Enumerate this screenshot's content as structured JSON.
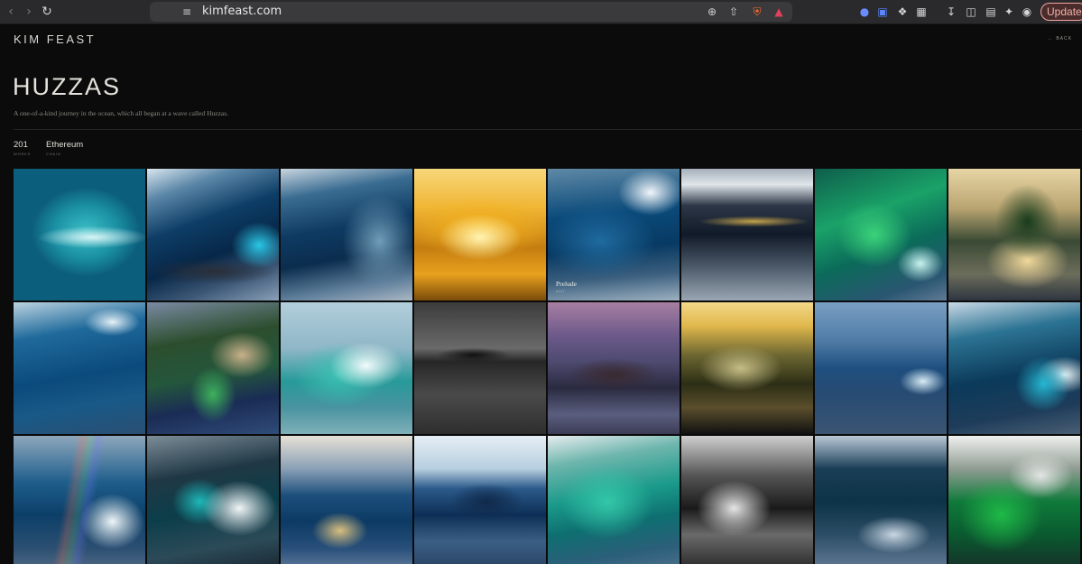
{
  "browser": {
    "url": "kimfeast.com",
    "update_label": "Update",
    "icons": {
      "back": "back-arrow-icon",
      "forward": "forward-arrow-icon",
      "reload": "reload-icon",
      "bookmark": "bookmark-icon",
      "site_settings": "site-settings-icon",
      "zoom": "zoom-icon",
      "share": "share-icon",
      "brave_shields": "brave-shields-icon",
      "brave_rewards": "brave-rewards-icon"
    }
  },
  "site": {
    "logo": "KIM FEAST",
    "back_label": "BACK",
    "collection_title": "HUZZAS",
    "description": "A one-of-a-kind journey in the ocean, which all began at a wave called Huzzas.",
    "stats": [
      {
        "value": "201",
        "label": "WORKS"
      },
      {
        "value": "Ethereum",
        "label": "CHAIN"
      }
    ]
  },
  "gallery": {
    "hover_caption": "Prelude",
    "hover_caption_sub": "#147",
    "tiles": 24
  },
  "colors": {
    "background": "#0b0b0b",
    "text": "#e6e3dc",
    "muted": "#8a8883",
    "update_accent": "#f4a7a0"
  }
}
